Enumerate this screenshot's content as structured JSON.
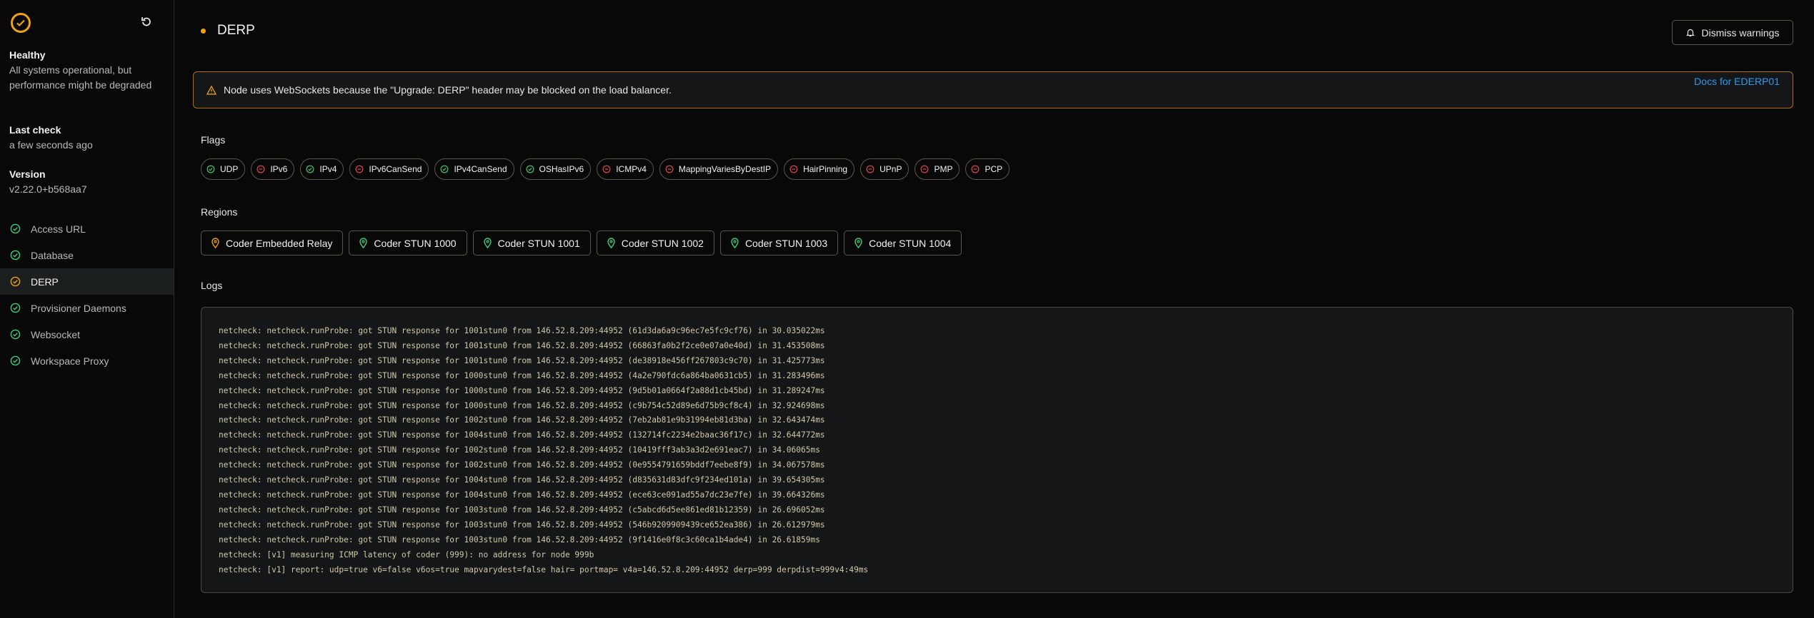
{
  "sidebar": {
    "status_title": "Healthy",
    "status_text": "All systems operational, but performance might be degraded",
    "last_check_label": "Last check",
    "last_check_value": "a few seconds ago",
    "version_label": "Version",
    "version_value": "v2.22.0+b568aa7",
    "items": [
      {
        "label": "Access URL",
        "status": "healthy"
      },
      {
        "label": "Database",
        "status": "healthy"
      },
      {
        "label": "DERP",
        "status": "warning",
        "active": true
      },
      {
        "label": "Provisioner Daemons",
        "status": "healthy"
      },
      {
        "label": "Websocket",
        "status": "healthy"
      },
      {
        "label": "Workspace Proxy",
        "status": "healthy"
      }
    ]
  },
  "header": {
    "title": "DERP",
    "dismiss_label": "Dismiss warnings"
  },
  "warning": {
    "text": "Node uses WebSockets because the \"Upgrade: DERP\" header may be blocked on the load balancer.",
    "link": "Docs for EDERP01"
  },
  "flags_label": "Flags",
  "flags": [
    {
      "label": "UDP",
      "ok": true
    },
    {
      "label": "IPv6",
      "ok": false
    },
    {
      "label": "IPv4",
      "ok": true
    },
    {
      "label": "IPv6CanSend",
      "ok": false
    },
    {
      "label": "IPv4CanSend",
      "ok": true
    },
    {
      "label": "OSHasIPv6",
      "ok": true
    },
    {
      "label": "ICMPv4",
      "ok": false
    },
    {
      "label": "MappingVariesByDestIP",
      "ok": false
    },
    {
      "label": "HairPinning",
      "ok": false
    },
    {
      "label": "UPnP",
      "ok": false
    },
    {
      "label": "PMP",
      "ok": false
    },
    {
      "label": "PCP",
      "ok": false
    }
  ],
  "regions_label": "Regions",
  "regions": [
    {
      "label": "Coder Embedded Relay",
      "status": "warning"
    },
    {
      "label": "Coder STUN 1000",
      "status": "healthy"
    },
    {
      "label": "Coder STUN 1001",
      "status": "healthy"
    },
    {
      "label": "Coder STUN 1002",
      "status": "healthy"
    },
    {
      "label": "Coder STUN 1003",
      "status": "healthy"
    },
    {
      "label": "Coder STUN 1004",
      "status": "healthy"
    }
  ],
  "logs_label": "Logs",
  "logs": [
    "netcheck: netcheck.runProbe: got STUN response for 1001stun0 from 146.52.8.209:44952 (61d3da6a9c96ec7e5fc9cf76) in 30.035022ms",
    "netcheck: netcheck.runProbe: got STUN response for 1001stun0 from 146.52.8.209:44952 (66863fa0b2f2ce0e07a0e40d) in 31.453508ms",
    "netcheck: netcheck.runProbe: got STUN response for 1001stun0 from 146.52.8.209:44952 (de38918e456ff267803c9c70) in 31.425773ms",
    "netcheck: netcheck.runProbe: got STUN response for 1000stun0 from 146.52.8.209:44952 (4a2e790fdc6a864ba0631cb5) in 31.283496ms",
    "netcheck: netcheck.runProbe: got STUN response for 1000stun0 from 146.52.8.209:44952 (9d5b01a0664f2a88d1cb45bd) in 31.289247ms",
    "netcheck: netcheck.runProbe: got STUN response for 1000stun0 from 146.52.8.209:44952 (c9b754c52d89e6d75b9cf8c4) in 32.924698ms",
    "netcheck: netcheck.runProbe: got STUN response for 1002stun0 from 146.52.8.209:44952 (7eb2ab81e9b31994eb81d3ba) in 32.643474ms",
    "netcheck: netcheck.runProbe: got STUN response for 1004stun0 from 146.52.8.209:44952 (132714fc2234e2baac36f17c) in 32.644772ms",
    "netcheck: netcheck.runProbe: got STUN response for 1002stun0 from 146.52.8.209:44952 (10419fff3ab3a3d2e691eac7) in 34.06065ms",
    "netcheck: netcheck.runProbe: got STUN response for 1002stun0 from 146.52.8.209:44952 (0e9554791659bddf7eebe8f9) in 34.067578ms",
    "netcheck: netcheck.runProbe: got STUN response for 1004stun0 from 146.52.8.209:44952 (d835631d83dfc9f234ed101a) in 39.654305ms",
    "netcheck: netcheck.runProbe: got STUN response for 1004stun0 from 146.52.8.209:44952 (ece63ce091ad55a7dc23e7fe) in 39.664326ms",
    "netcheck: netcheck.runProbe: got STUN response for 1003stun0 from 146.52.8.209:44952 (c5abcd6d5ee861ed81b12359) in 26.696052ms",
    "netcheck: netcheck.runProbe: got STUN response for 1003stun0 from 146.52.8.209:44952 (546b9209909439ce652ea386) in 26.612979ms",
    "netcheck: netcheck.runProbe: got STUN response for 1003stun0 from 146.52.8.209:44952 (9f1416e0f8c3c60ca1b4ade4) in 26.61859ms",
    "netcheck: [v1] measuring ICMP latency of coder (999): no address for node 999b",
    "netcheck: [v1] report: udp=true v6=false v6os=true mapvarydest=false hair= portmap= v4a=146.52.8.209:44952 derp=999 derpdist=999v4:49ms"
  ],
  "colors": {
    "healthy": "#3fcf74",
    "warning": "#f0a30f",
    "error": "#e5484d",
    "link": "#2b9bf0"
  }
}
